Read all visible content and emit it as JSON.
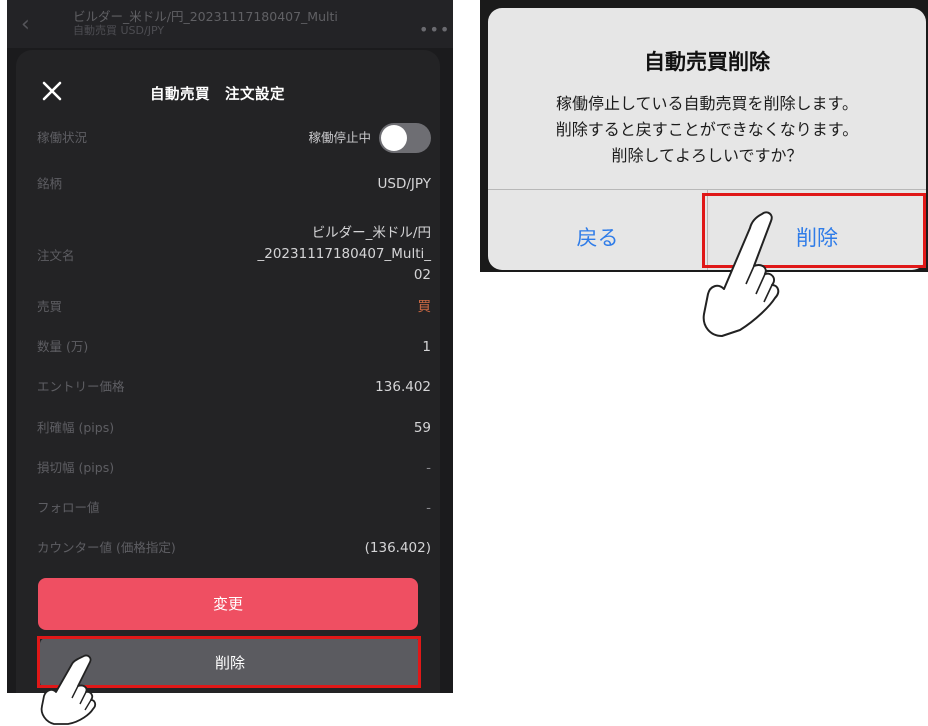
{
  "background_header": {
    "title": "ビルダー_米ドル/円_20231117180407_Multi",
    "subtitle": "自動売買 USD/JPY"
  },
  "sheet": {
    "title": "自動売買　注文設定",
    "rows": {
      "status": {
        "label": "稼働状況",
        "value": "稼働停止中",
        "toggle_on": false
      },
      "symbol": {
        "label": "銘柄",
        "value": "USD/JPY"
      },
      "order_name": {
        "label": "注文名",
        "line1": "ビルダー_米ドル/円",
        "line2": "_20231117180407_Multi_",
        "line3": "02"
      },
      "side": {
        "label": "売買",
        "value": "買"
      },
      "quantity": {
        "label": "数量 (万)",
        "value": "1"
      },
      "entry_price": {
        "label": "エントリー価格",
        "value": "136.402"
      },
      "take_profit": {
        "label": "利確幅 (pips)",
        "value": "59"
      },
      "stop_loss": {
        "label": "損切幅 (pips)",
        "value": "-"
      },
      "follow": {
        "label": "フォロー値",
        "value": "-"
      },
      "counter": {
        "label": "カウンター値 (価格指定)",
        "value": "(136.402)"
      }
    },
    "change_button": "変更",
    "delete_button": "削除"
  },
  "dialog": {
    "title": "自動売買削除",
    "message_line1": "稼働停止している自動売買を削除します。",
    "message_line2": "削除すると戻すことができなくなります。",
    "message_line3": "削除してよろしいですか？",
    "back_button": "戻る",
    "delete_button": "削除"
  },
  "colors": {
    "accent_red": "#ef4f62",
    "buy_orange": "#d06a44",
    "ios_blue": "#2f7ce8",
    "highlight_red": "#e01818"
  },
  "icons": [
    "back-chevron-icon",
    "more-dots-icon",
    "close-icon",
    "pointing-hand-icon"
  ]
}
